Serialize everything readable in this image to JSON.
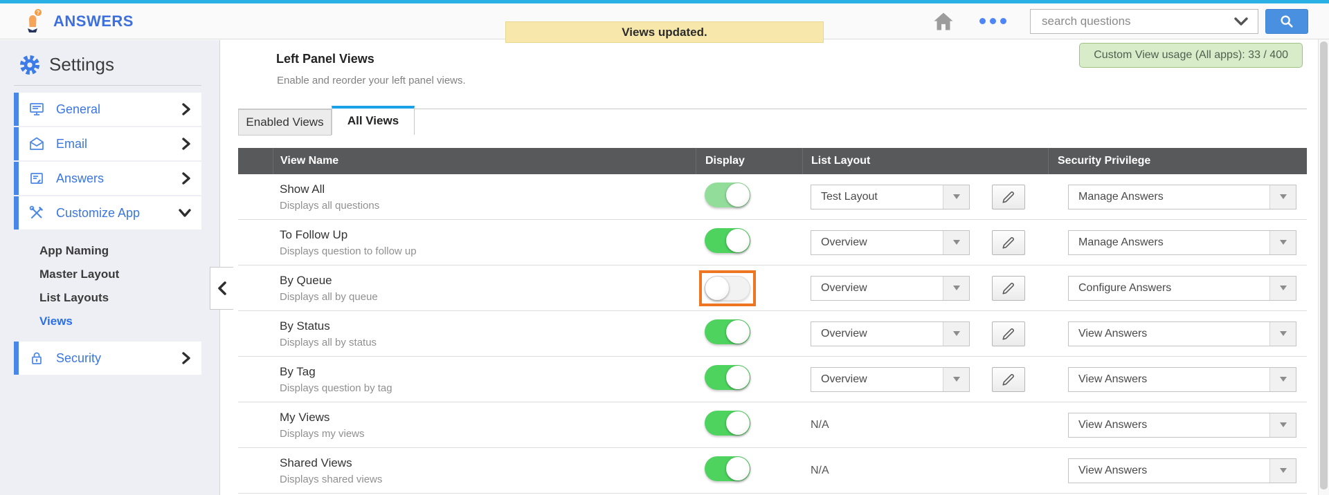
{
  "header": {
    "brand": "ANSWERS",
    "search_placeholder": "search questions"
  },
  "notification": {
    "message": "Views updated."
  },
  "sidebar": {
    "title": "Settings",
    "items": [
      {
        "label": "General",
        "icon": "monitor-icon"
      },
      {
        "label": "Email",
        "icon": "envelope-icon"
      },
      {
        "label": "Answers",
        "icon": "document-icon"
      },
      {
        "label": "Customize App",
        "icon": "tools-icon",
        "expanded": true
      }
    ],
    "sub_items": [
      "App Naming",
      "Master Layout",
      "List Layouts",
      "Views"
    ],
    "active_sub_item": "Views",
    "security_label": "Security"
  },
  "main": {
    "title": "Left Panel Views",
    "subtitle": "Enable and reorder your left panel views.",
    "usage_badge": "Custom View usage (All apps): 33 / 400",
    "tabs": [
      {
        "label": "Enabled Views",
        "active": false
      },
      {
        "label": "All Views",
        "active": true
      }
    ],
    "table": {
      "columns": [
        "View Name",
        "Display",
        "List Layout",
        "Security Privilege"
      ],
      "rows": [
        {
          "name": "Show All",
          "description": "Displays all questions",
          "display": true,
          "toggle_style": "light",
          "highlighted": false,
          "list_layout": "Test Layout",
          "has_edit": true,
          "security": "Manage Answers"
        },
        {
          "name": "To Follow Up",
          "description": "Displays question to follow up",
          "display": true,
          "toggle_style": "normal",
          "highlighted": false,
          "list_layout": "Overview",
          "has_edit": true,
          "security": "Manage Answers"
        },
        {
          "name": "By Queue",
          "description": "Displays all by queue",
          "display": false,
          "toggle_style": "normal",
          "highlighted": true,
          "list_layout": "Overview",
          "has_edit": true,
          "security": "Configure Answers"
        },
        {
          "name": "By Status",
          "description": "Displays all by status",
          "display": true,
          "toggle_style": "normal",
          "highlighted": false,
          "list_layout": "Overview",
          "has_edit": true,
          "security": "View Answers"
        },
        {
          "name": "By Tag",
          "description": "Displays question by tag",
          "display": true,
          "toggle_style": "normal",
          "highlighted": false,
          "list_layout": "Overview",
          "has_edit": true,
          "security": "View Answers"
        },
        {
          "name": "My Views",
          "description": "Displays my views",
          "display": true,
          "toggle_style": "normal",
          "highlighted": false,
          "list_layout": "N/A",
          "has_edit": false,
          "security": "View Answers"
        },
        {
          "name": "Shared Views",
          "description": "Displays shared views",
          "display": true,
          "toggle_style": "normal",
          "highlighted": false,
          "list_layout": "N/A",
          "has_edit": false,
          "security": "View Answers"
        }
      ]
    }
  },
  "colors": {
    "top_strip_cyan": "#29b1e6",
    "accent_blue": "#4a86e8",
    "brand_blue": "#3e70dd",
    "toggle_on_green": "#4ed35f",
    "toggle_light_green": "#93dd9b",
    "highlight_orange": "#ee7623",
    "banner_yellow_bg": "#f7e7aa",
    "badge_green_bg": "#d9ecca",
    "table_header_gray": "#58595b",
    "tab_active_blue": "#19a2e8"
  }
}
